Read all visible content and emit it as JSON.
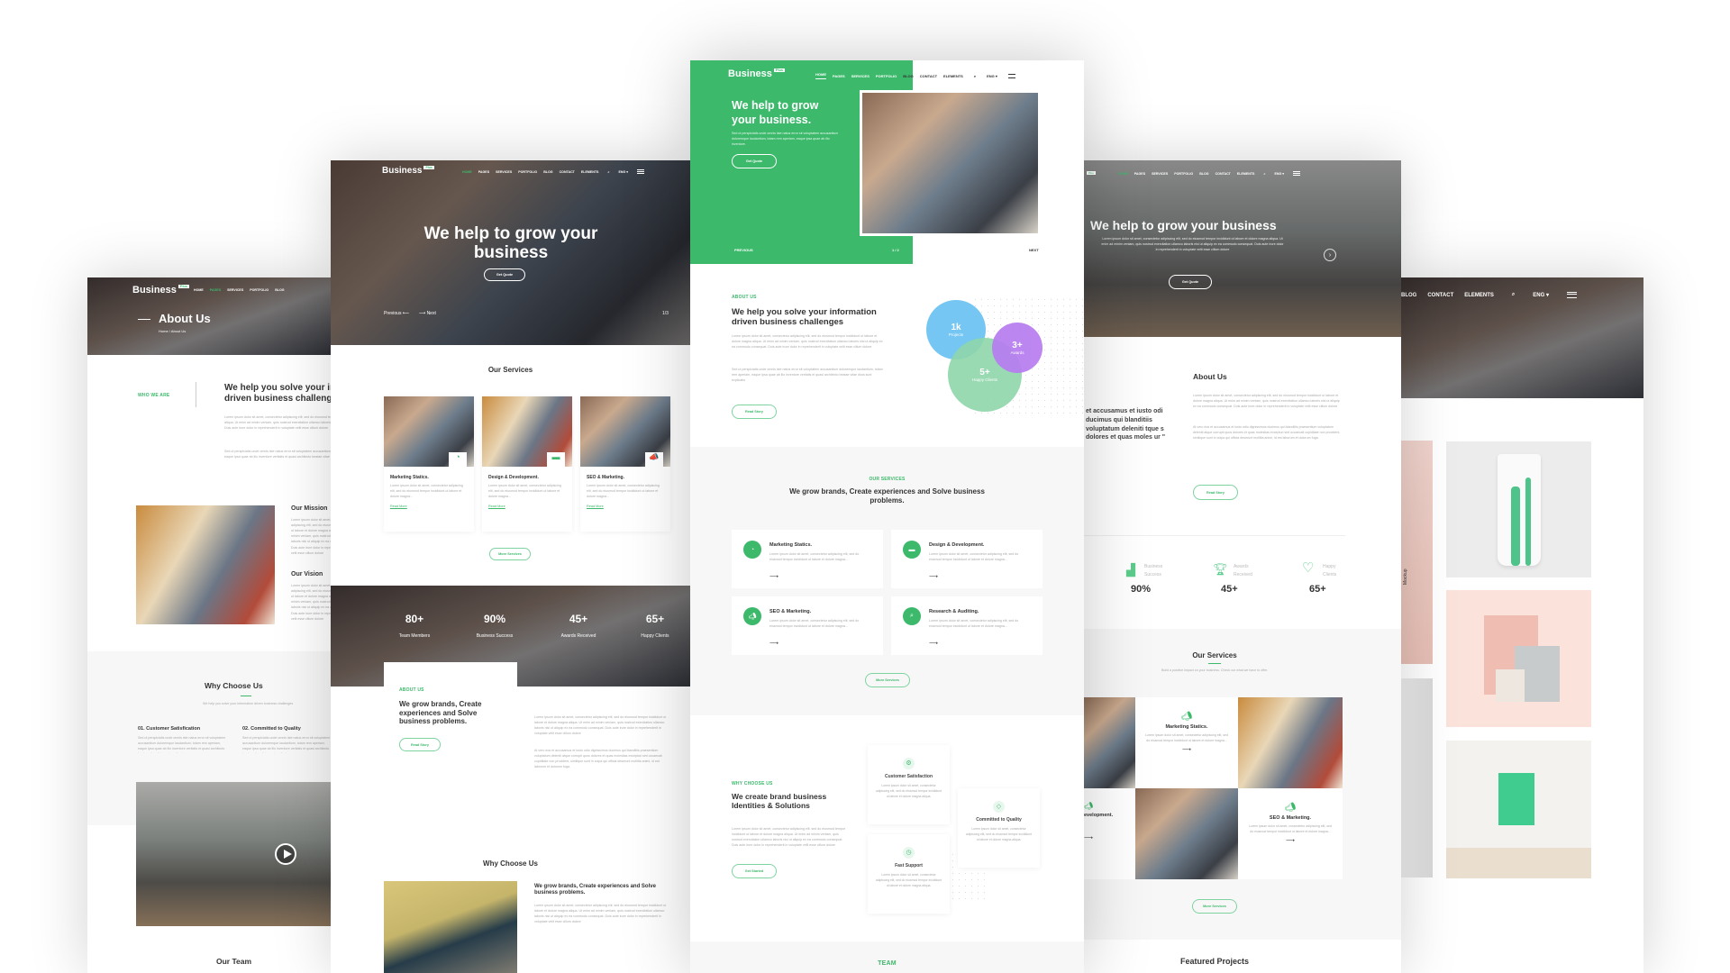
{
  "brand": {
    "name": "Business",
    "badge": "Plus",
    "accent": "#3cb96b"
  },
  "nav": {
    "items": [
      "HOME",
      "PAGES",
      "SERVICES",
      "PORTFOLIO",
      "BLOG",
      "CONTACT",
      "ELEMENTS"
    ],
    "lang": "ENG ▾",
    "search_icon": "search-icon",
    "menu_icon": "hamburger-icon"
  },
  "lorem": {
    "short": "Lorem ipsum dolor sit amet, consectetur adipiscing elit, sed do eiusmod tempor incididunt ut labore et dolore magna...",
    "long": "Lorem ipsum dolor sit amet, consectetur adipiscing elit, sed do eiusmod tempor incididunt ut labore et dolore magna aliqua. Ut enim ad minim veniam, quis nostrud exercitation ullamco laboris nisi ut aliquip ex ea commodo consequat. Duis aute irure dolor in reprehenderit in voluptate velit esse cillum dolore",
    "sed": "Sed ut perspiciatis unde omnis iste natus error sit voluptatem accusantium doloremque laudantium, totam rem aperiam, eaque ipsa quae ab illo inventore veritatis et quasi architecto beatae vitae dicta sunt explicabo",
    "at": "At vero eos et accusamus et iusto odio dignissimos ducimus qui blanditiis praesentium voluptatum deleniti atque corrupti quos dolores et quas molestias excepturi sint occaecati cupiditate non provident, similique sunt in culpa qui officia deserunt mollitia animi, id est laborum et dolorum fuga."
  },
  "about_page": {
    "title": "About Us",
    "breadcrumb": "Home / About Us",
    "who_label": "WHO WE ARE",
    "heading": "We help you solve your information driven business challenges",
    "mission": "Our Mission",
    "vision": "Our Vision",
    "why_title": "Why Choose Us",
    "why_sub": "We help you solve your information driven business challenges",
    "features": [
      "01. Customer Satisfication",
      "02. Committed to Quality"
    ],
    "team_title": "Our Team"
  },
  "home_b": {
    "hero_title": "We help to grow your business",
    "cta": "Get Quote",
    "prev": "Previous",
    "next": "Next",
    "counter": "1/3",
    "services_title": "Our Services",
    "services": [
      "Marketing Statics.",
      "Design & Development.",
      "SEO & Marketing."
    ],
    "read_more": "Read More",
    "more_services": "More Services",
    "stats": [
      {
        "value": "80+",
        "label": "Team Members"
      },
      {
        "value": "90%",
        "label": "Business Success"
      },
      {
        "value": "45+",
        "label": "Awards Received"
      },
      {
        "value": "65+",
        "label": "Happy Clients"
      }
    ],
    "about_label": "ABOUT US",
    "about_heading": "We grow brands, Create experiences and Solve business problems.",
    "read_story": "Read Story",
    "why_title": "Why Choose Us",
    "why_heading": "We grow brands, Create experiences and Solve business problems."
  },
  "home_c": {
    "hero_title": "We help to grow your business.",
    "hero_text": "Sed ut perspiciatis unde omnis iste natus error sit voluptatem accusantium doloremque laudantium, totam rem aperiam, eaque ipsa quae ab illo inventore.",
    "cta": "Get Quote",
    "prev": "PREVIOUS",
    "counter": "1 / 2",
    "next": "NEXT",
    "about_label": "ABOUT US",
    "about_heading": "We help you solve your information driven business challenges",
    "read_story": "Read Story",
    "bubbles": [
      {
        "value": "1k",
        "label": "Projects",
        "color": "#6ec3f2"
      },
      {
        "value": "3+",
        "label": "Awards",
        "color": "#b77cf0"
      },
      {
        "value": "5+",
        "label": "Happy Clients",
        "color": "#8fd6ab"
      }
    ],
    "services_label": "OUR SERVICES",
    "services_heading": "We grow brands, Create experiences and Solve business problems.",
    "services": [
      {
        "title": "Marketing Statics.",
        "icon": "pie-chart-icon"
      },
      {
        "title": "Design & Development.",
        "icon": "monitor-icon"
      },
      {
        "title": "SEO & Marketing.",
        "icon": "megaphone-icon"
      },
      {
        "title": "Research & Auditing.",
        "icon": "magnifier-icon"
      }
    ],
    "more_services": "More Services",
    "why_label": "WHY CHOOSE US",
    "why_heading": "We create brand business Identities & Solutions",
    "get_started": "Get Started",
    "features": [
      "Customer Satisfaction",
      "Fast Support",
      "Committed to Quality"
    ],
    "feature_text": "Lorem ipsum dolor sit amet, consectetur adipiscing elit, sed do eiusmod tempor incididunt ut labore et dolore magna aliqua.",
    "team_label": "TEAM"
  },
  "home_d": {
    "hero_title": "We help to grow your business",
    "cta": "Get Quote",
    "about_title": "About Us",
    "quote": "et accusamus et iusto odi ducimus qui blanditiis voluptatum deleniti tque s dolores et quas moles ur \"",
    "read_story": "Read Story",
    "stats": [
      {
        "label": "Business Success",
        "value": "90%",
        "icon": "bar-chart-icon"
      },
      {
        "label": "Awards Received",
        "value": "45+",
        "icon": "trophy-icon"
      },
      {
        "label": "Happy Clients",
        "value": "65+",
        "icon": "heart-icon"
      }
    ],
    "services_title": "Our Services",
    "services_sub": "Build a positive impact on your business. Check out what we have to offer.",
    "services": [
      "Marketing Statics.",
      "evelopment.",
      "SEO & Marketing."
    ],
    "more_services": "More Services",
    "featured_title": "Featured Projects"
  },
  "portfolio_e": {
    "nav": [
      "BLOG",
      "CONTACT",
      "ELEMENTS"
    ],
    "lang": "ENG ▾",
    "mockup_label": "Mockup"
  }
}
